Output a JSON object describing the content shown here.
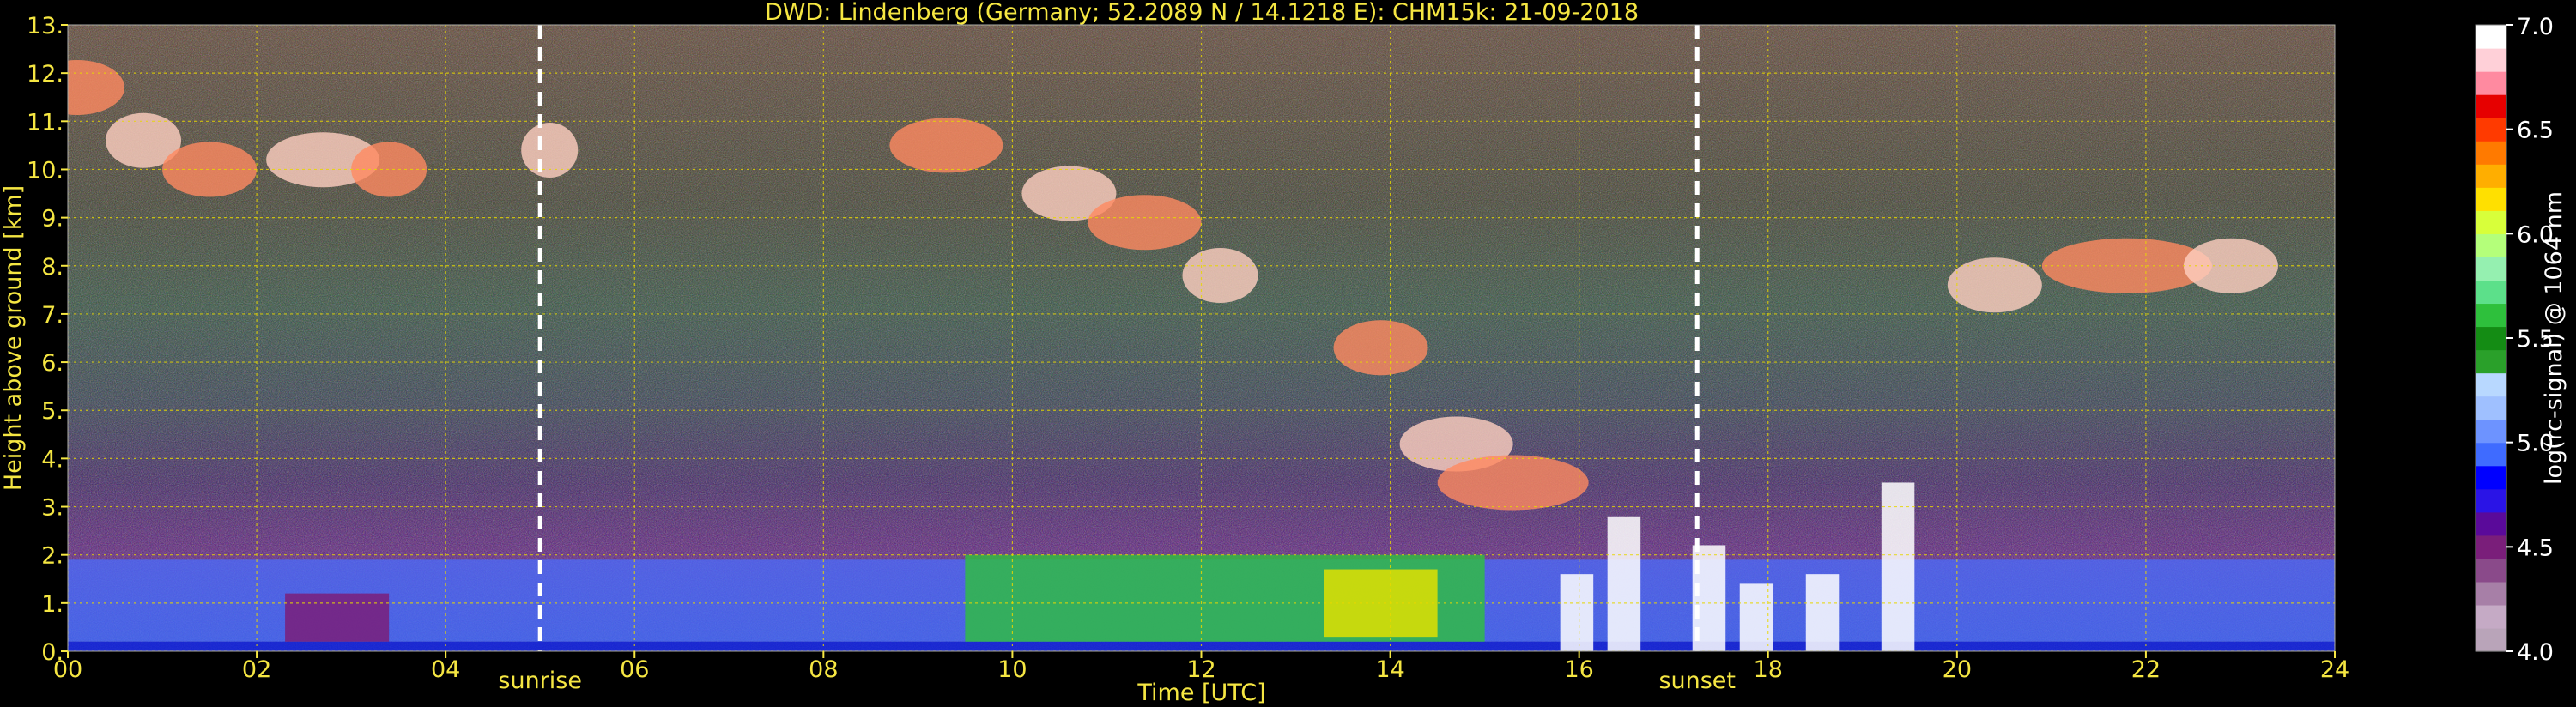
{
  "chart_data": {
    "type": "heatmap",
    "title": "DWD: Lindenberg (Germany; 52.2089 N / 14.1218 E):     CHM15k: 21-09-2018",
    "xlabel": "Time [UTC]",
    "ylabel": "Height above ground [km]",
    "xlim": [
      0,
      24
    ],
    "ylim": [
      0,
      13
    ],
    "x_ticks": [
      {
        "v": 0,
        "label": "00"
      },
      {
        "v": 2,
        "label": "02"
      },
      {
        "v": 4,
        "label": "04"
      },
      {
        "v": 6,
        "label": "06"
      },
      {
        "v": 8,
        "label": "08"
      },
      {
        "v": 10,
        "label": "10"
      },
      {
        "v": 12,
        "label": "12"
      },
      {
        "v": 14,
        "label": "14"
      },
      {
        "v": 16,
        "label": "16"
      },
      {
        "v": 18,
        "label": "18"
      },
      {
        "v": 20,
        "label": "20"
      },
      {
        "v": 22,
        "label": "22"
      },
      {
        "v": 24,
        "label": "24"
      }
    ],
    "y_ticks": [
      {
        "v": 0,
        "label": "0."
      },
      {
        "v": 1,
        "label": "1."
      },
      {
        "v": 2,
        "label": "2."
      },
      {
        "v": 3,
        "label": "3."
      },
      {
        "v": 4,
        "label": "4."
      },
      {
        "v": 5,
        "label": "5."
      },
      {
        "v": 6,
        "label": "6."
      },
      {
        "v": 7,
        "label": "7."
      },
      {
        "v": 8,
        "label": "8."
      },
      {
        "v": 9,
        "label": "9."
      },
      {
        "v": 10,
        "label": "10."
      },
      {
        "v": 11,
        "label": "11."
      },
      {
        "v": 12,
        "label": "12."
      },
      {
        "v": 13,
        "label": "13."
      }
    ],
    "grid": true,
    "grid_color": "#e8d800",
    "markers": [
      {
        "x": 5.0,
        "label": "sunrise"
      },
      {
        "x": 17.25,
        "label": "sunset"
      }
    ],
    "colorbar": {
      "label": "log(rc-signal) @ 1064 nm",
      "range": [
        4.0,
        7.0
      ],
      "ticks": [
        {
          "v": 4.0,
          "label": "4.0"
        },
        {
          "v": 4.5,
          "label": "4.5"
        },
        {
          "v": 5.0,
          "label": "5.0"
        },
        {
          "v": 5.5,
          "label": "5.5"
        },
        {
          "v": 6.0,
          "label": "6.0"
        },
        {
          "v": 6.5,
          "label": "6.5"
        },
        {
          "v": 7.0,
          "label": "7.0"
        }
      ],
      "colors": [
        "#b9a4b9",
        "#c5aac5",
        "#a77fa7",
        "#8a4a8a",
        "#7a1e7a",
        "#5a0a9a",
        "#2a14e6",
        "#0000ff",
        "#3f6bff",
        "#6d93ff",
        "#9fc0ff",
        "#b8d8ff",
        "#2aa02a",
        "#148c14",
        "#2ec03c",
        "#5ce08a",
        "#95f0b0",
        "#b4ff7a",
        "#d8ff3a",
        "#ffe000",
        "#ffae00",
        "#ff7a00",
        "#ff3a00",
        "#e60000",
        "#ff8aa0",
        "#ffd0d8",
        "#ffffff"
      ]
    },
    "features": {
      "boundary_layer_km": [
        0.2,
        1.9
      ],
      "convective_layer_hours": [
        9.5,
        15.0
      ],
      "cirrus_layer_km": [
        7.0,
        12.0
      ],
      "clouds_descending_hours": [
        14.0,
        19.5
      ]
    }
  }
}
